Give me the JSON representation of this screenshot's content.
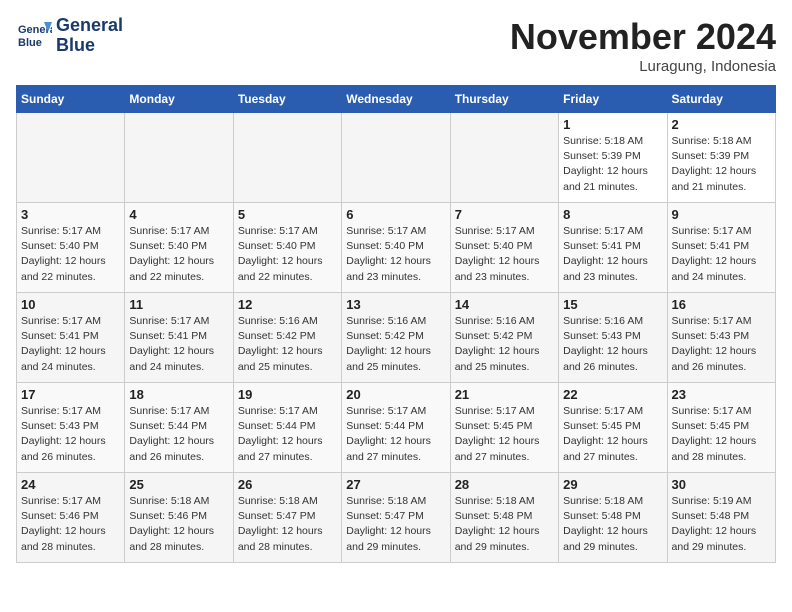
{
  "logo": {
    "line1": "General",
    "line2": "Blue"
  },
  "title": "November 2024",
  "location": "Luragung, Indonesia",
  "weekdays": [
    "Sunday",
    "Monday",
    "Tuesday",
    "Wednesday",
    "Thursday",
    "Friday",
    "Saturday"
  ],
  "weeks": [
    [
      {
        "day": "",
        "info": ""
      },
      {
        "day": "",
        "info": ""
      },
      {
        "day": "",
        "info": ""
      },
      {
        "day": "",
        "info": ""
      },
      {
        "day": "",
        "info": ""
      },
      {
        "day": "1",
        "info": "Sunrise: 5:18 AM\nSunset: 5:39 PM\nDaylight: 12 hours\nand 21 minutes."
      },
      {
        "day": "2",
        "info": "Sunrise: 5:18 AM\nSunset: 5:39 PM\nDaylight: 12 hours\nand 21 minutes."
      }
    ],
    [
      {
        "day": "3",
        "info": "Sunrise: 5:17 AM\nSunset: 5:40 PM\nDaylight: 12 hours\nand 22 minutes."
      },
      {
        "day": "4",
        "info": "Sunrise: 5:17 AM\nSunset: 5:40 PM\nDaylight: 12 hours\nand 22 minutes."
      },
      {
        "day": "5",
        "info": "Sunrise: 5:17 AM\nSunset: 5:40 PM\nDaylight: 12 hours\nand 22 minutes."
      },
      {
        "day": "6",
        "info": "Sunrise: 5:17 AM\nSunset: 5:40 PM\nDaylight: 12 hours\nand 23 minutes."
      },
      {
        "day": "7",
        "info": "Sunrise: 5:17 AM\nSunset: 5:40 PM\nDaylight: 12 hours\nand 23 minutes."
      },
      {
        "day": "8",
        "info": "Sunrise: 5:17 AM\nSunset: 5:41 PM\nDaylight: 12 hours\nand 23 minutes."
      },
      {
        "day": "9",
        "info": "Sunrise: 5:17 AM\nSunset: 5:41 PM\nDaylight: 12 hours\nand 24 minutes."
      }
    ],
    [
      {
        "day": "10",
        "info": "Sunrise: 5:17 AM\nSunset: 5:41 PM\nDaylight: 12 hours\nand 24 minutes."
      },
      {
        "day": "11",
        "info": "Sunrise: 5:17 AM\nSunset: 5:41 PM\nDaylight: 12 hours\nand 24 minutes."
      },
      {
        "day": "12",
        "info": "Sunrise: 5:16 AM\nSunset: 5:42 PM\nDaylight: 12 hours\nand 25 minutes."
      },
      {
        "day": "13",
        "info": "Sunrise: 5:16 AM\nSunset: 5:42 PM\nDaylight: 12 hours\nand 25 minutes."
      },
      {
        "day": "14",
        "info": "Sunrise: 5:16 AM\nSunset: 5:42 PM\nDaylight: 12 hours\nand 25 minutes."
      },
      {
        "day": "15",
        "info": "Sunrise: 5:16 AM\nSunset: 5:43 PM\nDaylight: 12 hours\nand 26 minutes."
      },
      {
        "day": "16",
        "info": "Sunrise: 5:17 AM\nSunset: 5:43 PM\nDaylight: 12 hours\nand 26 minutes."
      }
    ],
    [
      {
        "day": "17",
        "info": "Sunrise: 5:17 AM\nSunset: 5:43 PM\nDaylight: 12 hours\nand 26 minutes."
      },
      {
        "day": "18",
        "info": "Sunrise: 5:17 AM\nSunset: 5:44 PM\nDaylight: 12 hours\nand 26 minutes."
      },
      {
        "day": "19",
        "info": "Sunrise: 5:17 AM\nSunset: 5:44 PM\nDaylight: 12 hours\nand 27 minutes."
      },
      {
        "day": "20",
        "info": "Sunrise: 5:17 AM\nSunset: 5:44 PM\nDaylight: 12 hours\nand 27 minutes."
      },
      {
        "day": "21",
        "info": "Sunrise: 5:17 AM\nSunset: 5:45 PM\nDaylight: 12 hours\nand 27 minutes."
      },
      {
        "day": "22",
        "info": "Sunrise: 5:17 AM\nSunset: 5:45 PM\nDaylight: 12 hours\nand 27 minutes."
      },
      {
        "day": "23",
        "info": "Sunrise: 5:17 AM\nSunset: 5:45 PM\nDaylight: 12 hours\nand 28 minutes."
      }
    ],
    [
      {
        "day": "24",
        "info": "Sunrise: 5:17 AM\nSunset: 5:46 PM\nDaylight: 12 hours\nand 28 minutes."
      },
      {
        "day": "25",
        "info": "Sunrise: 5:18 AM\nSunset: 5:46 PM\nDaylight: 12 hours\nand 28 minutes."
      },
      {
        "day": "26",
        "info": "Sunrise: 5:18 AM\nSunset: 5:47 PM\nDaylight: 12 hours\nand 28 minutes."
      },
      {
        "day": "27",
        "info": "Sunrise: 5:18 AM\nSunset: 5:47 PM\nDaylight: 12 hours\nand 29 minutes."
      },
      {
        "day": "28",
        "info": "Sunrise: 5:18 AM\nSunset: 5:48 PM\nDaylight: 12 hours\nand 29 minutes."
      },
      {
        "day": "29",
        "info": "Sunrise: 5:18 AM\nSunset: 5:48 PM\nDaylight: 12 hours\nand 29 minutes."
      },
      {
        "day": "30",
        "info": "Sunrise: 5:19 AM\nSunset: 5:48 PM\nDaylight: 12 hours\nand 29 minutes."
      }
    ]
  ]
}
